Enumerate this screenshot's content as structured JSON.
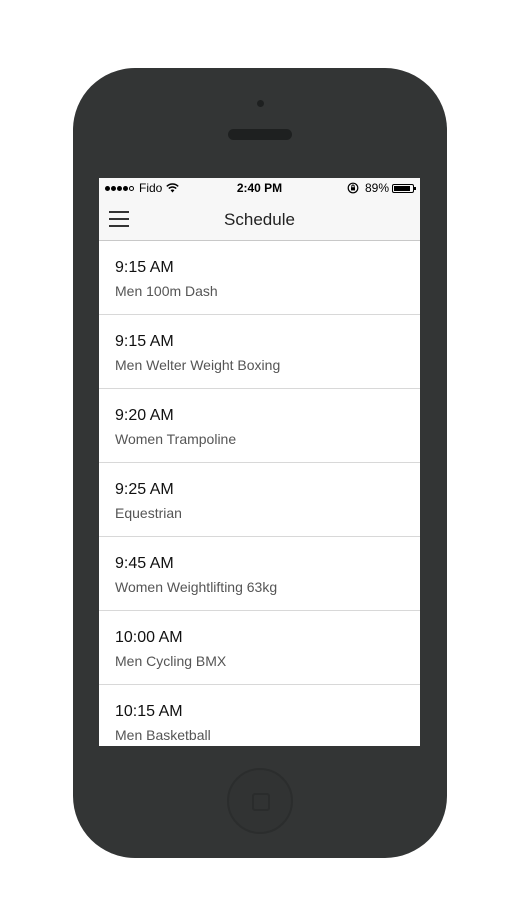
{
  "status_bar": {
    "carrier": "Fido",
    "signal_bars": 4,
    "signal_total": 5,
    "time": "2:40 PM",
    "battery": "89%",
    "battery_level": 0.89
  },
  "nav": {
    "title": "Schedule",
    "menu_icon": "hamburger-menu-icon"
  },
  "schedule": [
    {
      "time": "9:15 AM",
      "event": "Men 100m Dash"
    },
    {
      "time": "9:15 AM",
      "event": "Men Welter Weight Boxing"
    },
    {
      "time": "9:20 AM",
      "event": "Women Trampoline"
    },
    {
      "time": "9:25 AM",
      "event": "Equestrian"
    },
    {
      "time": "9:45 AM",
      "event": "Women Weightlifting 63kg"
    },
    {
      "time": "10:00 AM",
      "event": "Men Cycling BMX"
    },
    {
      "time": "10:15 AM",
      "event": "Men Basketball"
    }
  ],
  "colors": {
    "phone_body": "#333535",
    "bar_background": "#f7f7f7",
    "event_text": "#555555"
  }
}
